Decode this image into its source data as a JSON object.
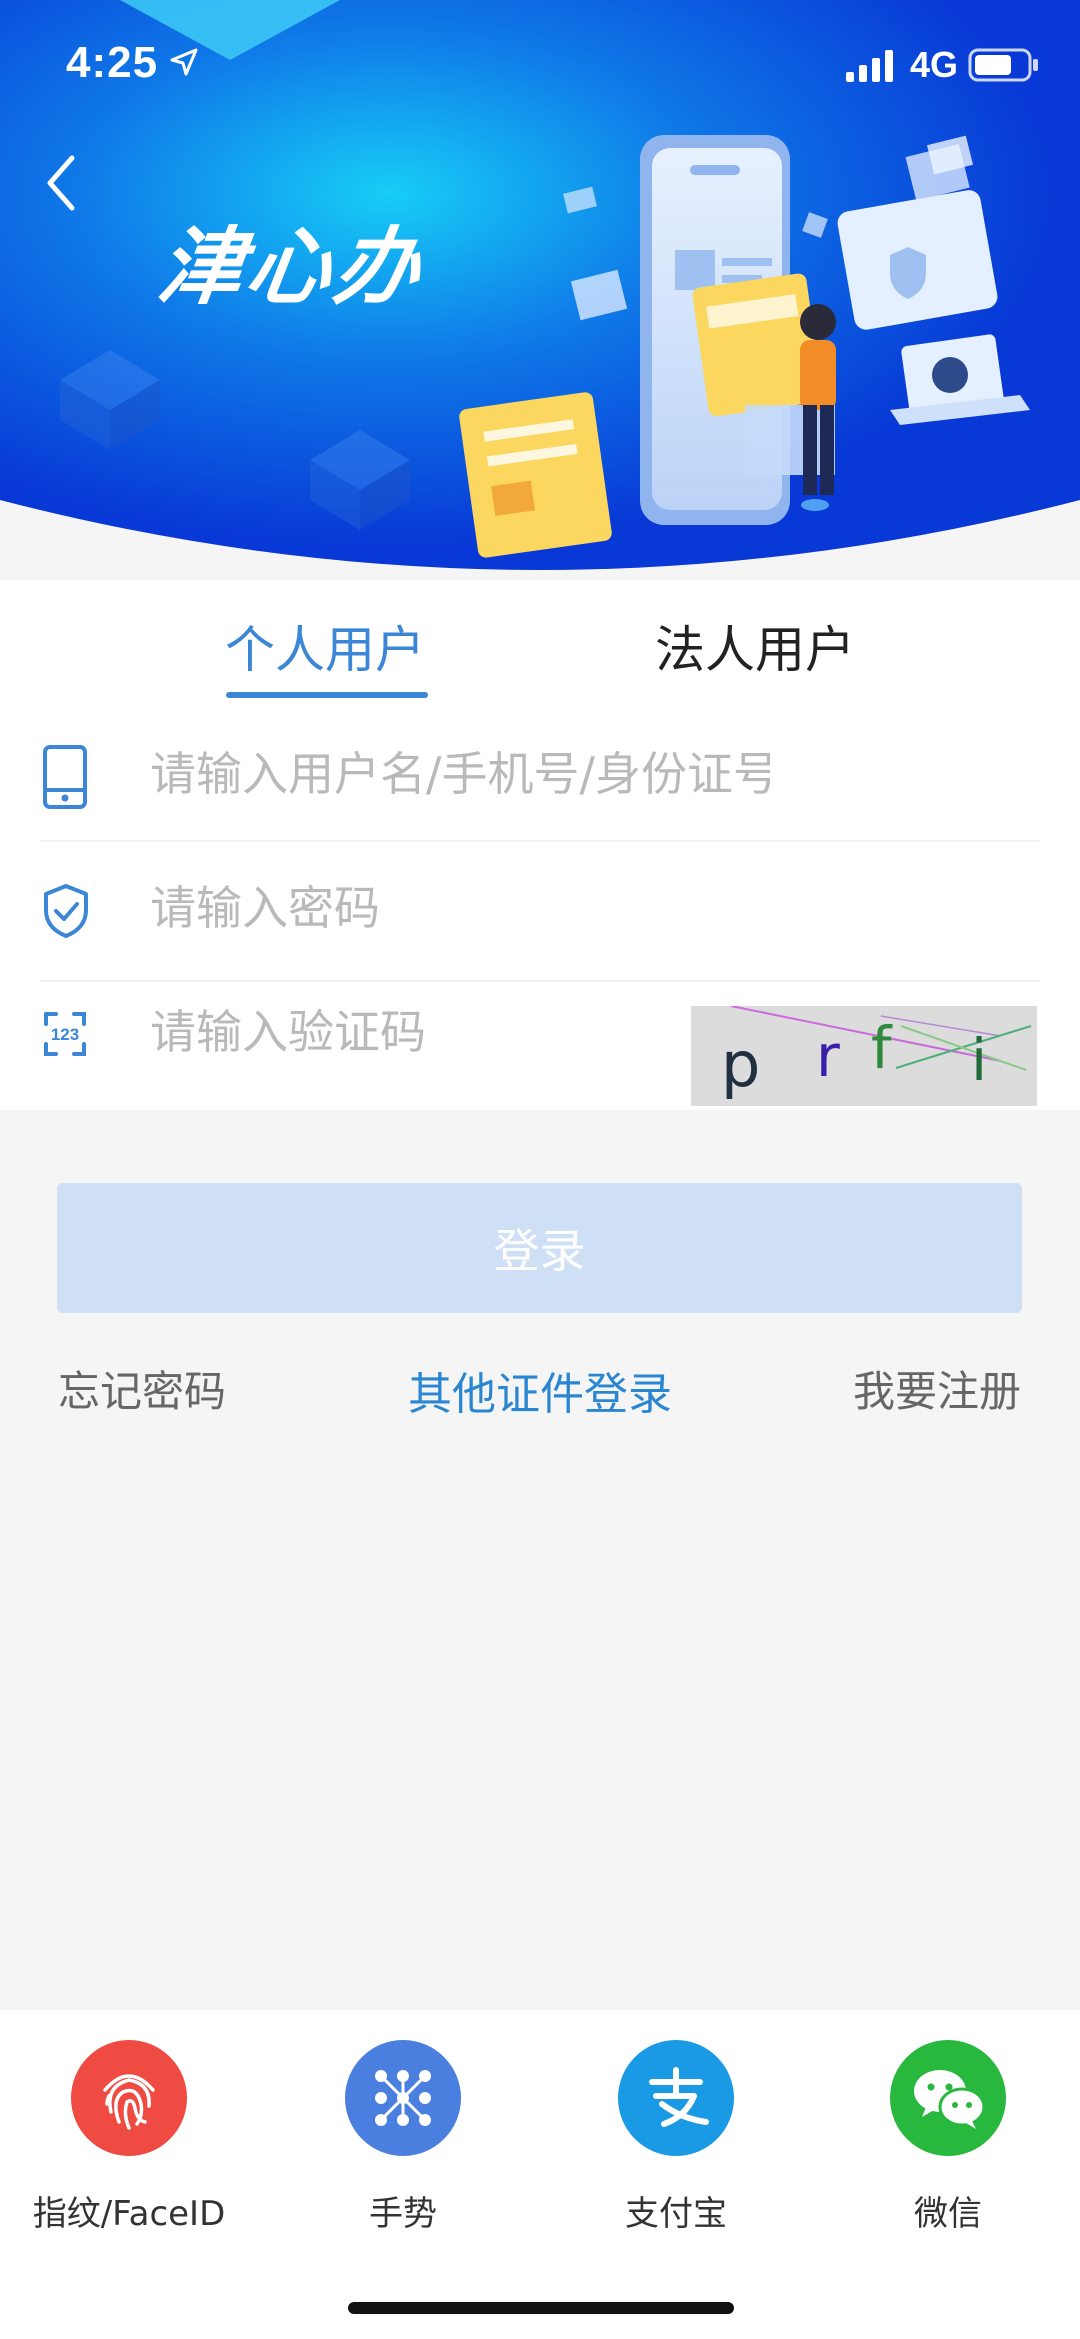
{
  "status_bar": {
    "time": "4:25",
    "network": "4G"
  },
  "header": {
    "brand": "津心办"
  },
  "tabs": [
    {
      "label": "个人用户",
      "active": true
    },
    {
      "label": "法人用户",
      "active": false
    }
  ],
  "form": {
    "username_placeholder": "请输入用户名/手机号/身份证号",
    "password_placeholder": "请输入密码",
    "captcha_placeholder": "请输入验证码",
    "captcha_chars": [
      "p",
      "r",
      "f",
      "i"
    ]
  },
  "actions": {
    "login_label": "登录",
    "forgot_password": "忘记密码",
    "other_login": "其他证件登录",
    "register": "我要注册"
  },
  "quick_login": [
    {
      "label": "指纹/FaceID",
      "icon": "fingerprint-icon",
      "color": "#ef4b43"
    },
    {
      "label": "手势",
      "icon": "gesture-icon",
      "color": "#4a7fe0"
    },
    {
      "label": "支付宝",
      "icon": "alipay-icon",
      "color": "#1a9ae4"
    },
    {
      "label": "微信",
      "icon": "wechat-icon",
      "color": "#27b83d"
    }
  ],
  "colors": {
    "accent": "#3b86d6",
    "hero_top": "#0a43e0",
    "hero_glow": "#16c6f5",
    "login_button": "#cfdff6",
    "page_bg": "#f6f5f6"
  }
}
